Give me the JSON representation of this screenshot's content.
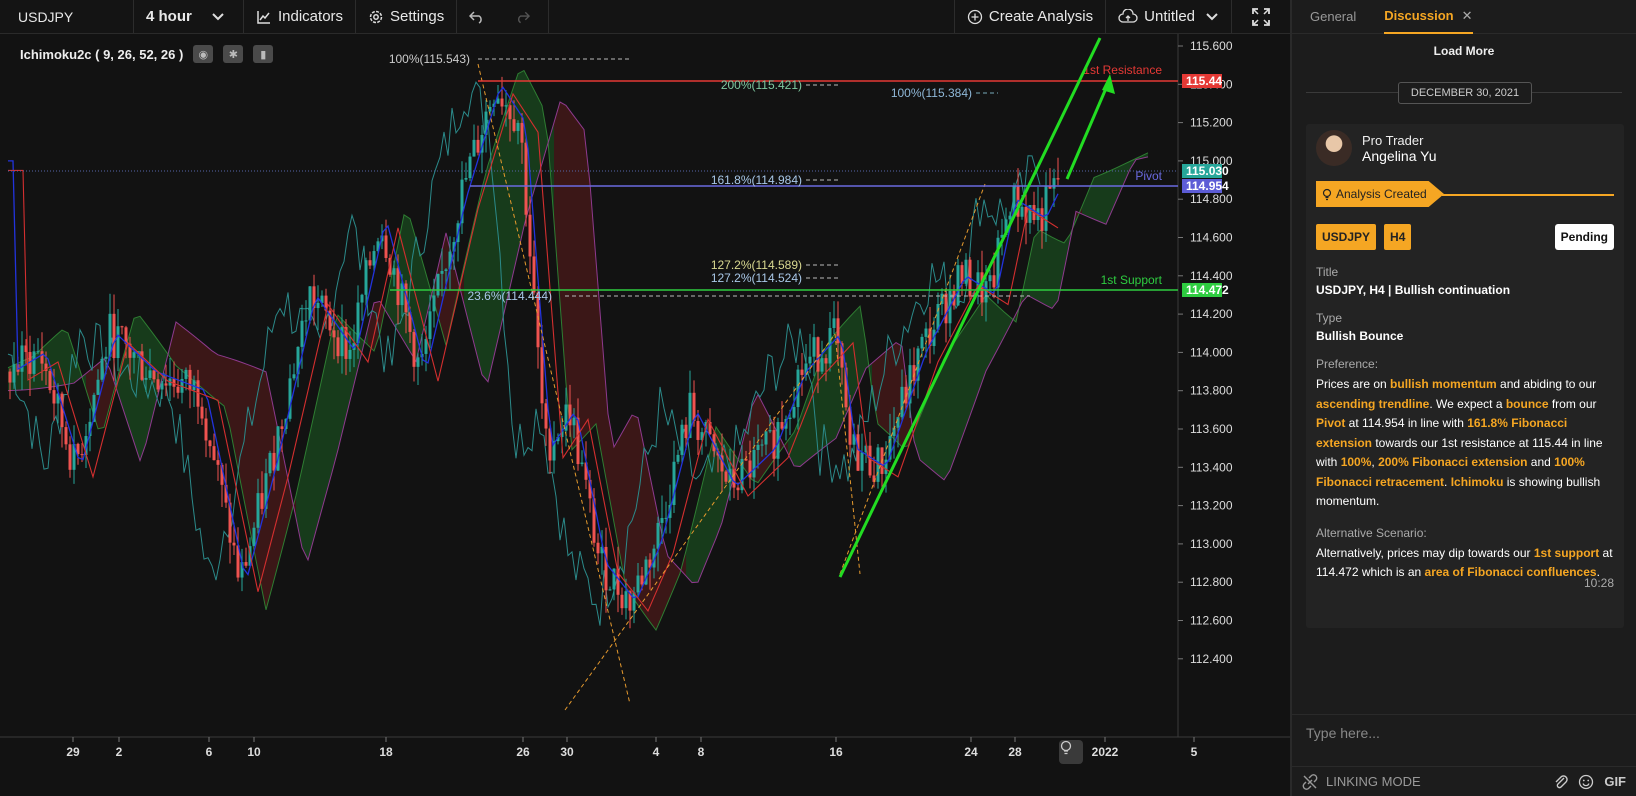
{
  "toolbar": {
    "symbol": "USDJPY",
    "interval": "4 hour",
    "indicators_label": "Indicators",
    "settings_label": "Settings",
    "create_analysis_label": "Create Analysis",
    "layout_name": "Untitled"
  },
  "chart": {
    "indicator_label": "Ichimoku2c ( 9, 26, 52, 26 )",
    "y_ticks": [
      "115.600",
      "115.400",
      "115.200",
      "115.000",
      "114.800",
      "114.600",
      "114.400",
      "114.200",
      "114.000",
      "113.800",
      "113.600",
      "113.400",
      "113.200",
      "113.000",
      "112.800",
      "112.600",
      "112.400"
    ],
    "x_ticks": [
      "29",
      "2",
      "6",
      "10",
      "18",
      "26",
      "30",
      "4",
      "8",
      "16",
      "24",
      "28",
      "2022",
      "5"
    ],
    "price_tags": [
      {
        "label": "115.44",
        "color": "#e53935"
      },
      {
        "label": "115.030",
        "color": "#26a69a"
      },
      {
        "label": "114.954",
        "color": "#5c5cd6"
      },
      {
        "label": "114.472",
        "color": "#2ecc40"
      }
    ],
    "level_labels": {
      "resistance": "1st Resistance",
      "pivot": "Pivot",
      "support": "1st Support"
    },
    "fib_labels": [
      "100%(115.543)",
      "200%(115.421)",
      "100%(115.384)",
      "161.8%(114.984)",
      "127.2%(114.589)",
      "127.2%(114.524)",
      "23.6%(114.444)"
    ],
    "colors": {
      "resistance": "#e53935",
      "pivot": "#6a6ae0",
      "support": "#2ecc40",
      "up_candle": "#26a69a",
      "down_candle": "#ef5350",
      "trend": "#22dd22"
    }
  },
  "panel": {
    "tabs": [
      {
        "label": "General"
      },
      {
        "label": "Discussion"
      }
    ],
    "load_more": "Load More",
    "date": "DECEMBER 30, 2021",
    "author_role": "Pro Trader",
    "author_name": "Angelina Yu",
    "status": "Analysis Created",
    "tags": [
      "USDJPY",
      "H4"
    ],
    "pending": "Pending",
    "title_label": "Title",
    "title_value": "USDJPY, H4 | Bullish continuation",
    "type_label": "Type",
    "type_value": "Bullish Bounce",
    "preference_label": "Preference:",
    "preference": {
      "t1": "Prices are on ",
      "h1": "bullish momentum",
      "t2": " and abiding to our ",
      "h2": "ascending trendline",
      "t3": ". We expect a ",
      "h3": "bounce",
      "t4": " from our ",
      "h4": "Pivot",
      "t5": " at 114.954 in line with ",
      "h5": "161.8% Fibonacci extension",
      "t6": " towards our 1st resistance at 115.44 in line with ",
      "h6": "100%",
      "t7": ", ",
      "h7": "200% Fibonacci extension",
      "t8": " and ",
      "h8": "100% Fibonacci retracement",
      "t9": ". ",
      "h9": "Ichimoku",
      "t10": " is showing bullish momentum."
    },
    "alt_label": "Alternative Scenario:",
    "alt": {
      "t1": "Alternatively,  prices may dip towards our ",
      "h1": "1st support",
      "t2": " at 114.472 which is an ",
      "h2": "area of Fibonacci confluences",
      "t3": "."
    },
    "time": "10:28",
    "input_placeholder": "Type here...",
    "linking_mode": "LINKING MODE",
    "gif": "GIF"
  }
}
